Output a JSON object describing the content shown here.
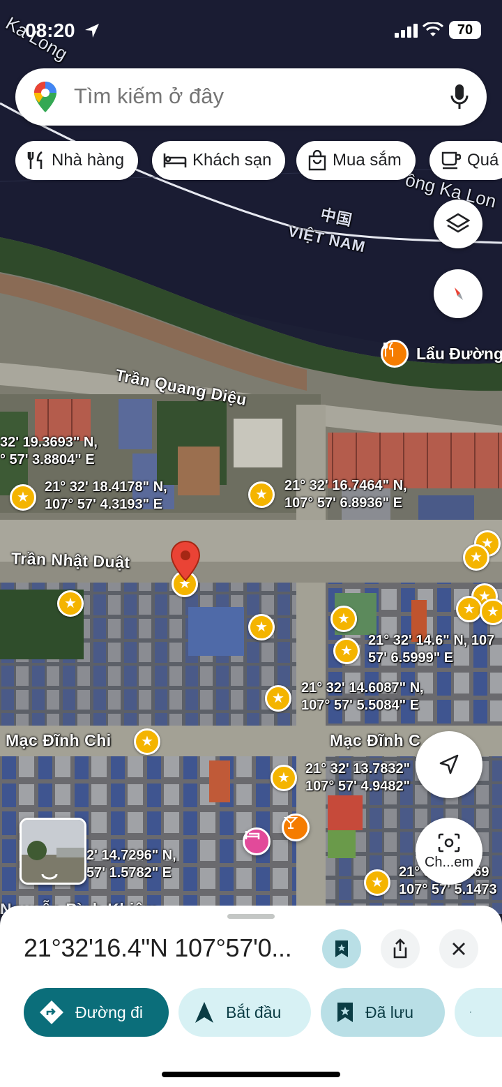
{
  "status_bar": {
    "time": "08:20",
    "battery": "70"
  },
  "search": {
    "placeholder": "Tìm kiếm ở đây"
  },
  "chips": [
    {
      "label": "Nhà hàng",
      "icon": "restaurant-icon"
    },
    {
      "label": "Khách sạn",
      "icon": "hotel-icon"
    },
    {
      "label": "Mua sắm",
      "icon": "shopping-bag-icon"
    },
    {
      "label": "Quá",
      "icon": "coffee-icon"
    }
  ],
  "map": {
    "river_labels": [
      "Ka Long",
      "ông Ka Lon"
    ],
    "border": {
      "north": "中国",
      "south": "VIỆT NAM"
    },
    "streets": [
      "Trần Quang Diệu",
      "Trần Nhật Duật",
      "Mạc Đĩnh Chi",
      "Mạc Đĩnh C",
      "Nguyễn Bình Khiêm"
    ],
    "poi": {
      "restaurant": "Lẩu Đường"
    },
    "coordinates": [
      "32' 19.3693\" N,\n° 57' 3.8804\" E",
      "21° 32' 18.4178\" N,\n107° 57' 4.3193\" E",
      "21° 32' 16.7464\" N,\n107° 57' 6.8936\" E",
      "21° 32' 14.6\" N, 107\n57' 6.5999\" E",
      "21° 32' 14.6087\" N,\n107° 57' 5.5084\" E",
      "21° 32' 13.7832\"\n107° 57' 4.9482\"",
      "2' 14.7296\" N,\n57' 1.5782\" E",
      "21° 32' 12.869\n107° 57' 5.1473"
    ]
  },
  "side_controls": {
    "lens_label": "Ch...em"
  },
  "sheet": {
    "title": "21°32'16.4\"N 107°57'0...",
    "actions": [
      {
        "label": "Đường đi",
        "icon": "directions-icon",
        "bg": "#0b6e7a",
        "fg": "#ffffff"
      },
      {
        "label": "Bắt đầu",
        "icon": "navigation-arrow-icon",
        "bg": "#d7f1f4",
        "fg": "#0b3d45"
      },
      {
        "label": "Đã lưu",
        "icon": "saved-bookmark-icon",
        "bg": "#b9dfe6",
        "fg": "#0b3d45"
      },
      {
        "label": "",
        "icon": "flag-icon",
        "bg": "#d7f1f4",
        "fg": "#0b3d45"
      }
    ]
  },
  "colors": {
    "star": "#f4b400",
    "pin": "#ea4335",
    "accent": "#0b6e7a"
  }
}
